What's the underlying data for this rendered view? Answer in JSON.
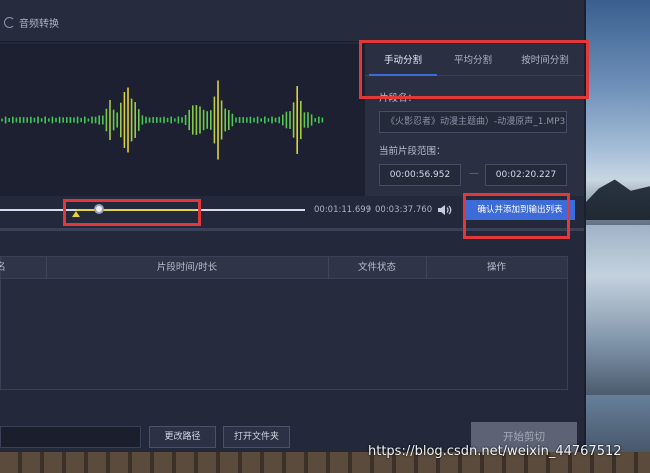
{
  "app": {
    "nav": {
      "label": "音频转换",
      "icon": "convert-icon"
    }
  },
  "split_panel": {
    "tabs": [
      {
        "label": "手动分割",
        "active": true
      },
      {
        "label": "平均分割",
        "active": false
      },
      {
        "label": "按时间分割",
        "active": false
      }
    ],
    "name_label": "片段名：",
    "name_placeholder": "《火影忍者》动漫主题曲）-动漫原声_1.MP3",
    "range_label": "当前片段范围：",
    "range_start": "00:00:56.952",
    "range_sep": "—",
    "range_end": "00:02:20.227"
  },
  "timeline": {
    "current": "00:01:11.699",
    "separator": "/",
    "total": "00:03:37.760",
    "confirm_label": "确认并添加到输出列表"
  },
  "table": {
    "columns": [
      "名",
      "片段时间/时长",
      "文件状态",
      "操作"
    ]
  },
  "bottom": {
    "change_path": "更改路径",
    "open_folder": "打开文件夹",
    "start_cut": "开始剪切"
  },
  "watermark": "https://blog.csdn.net/weixin_44767512",
  "colors": {
    "accent": "#3d6bd8",
    "annotation": "#e0383b",
    "wave_green": "#31c35a",
    "wave_yellow": "#e2d13a"
  }
}
